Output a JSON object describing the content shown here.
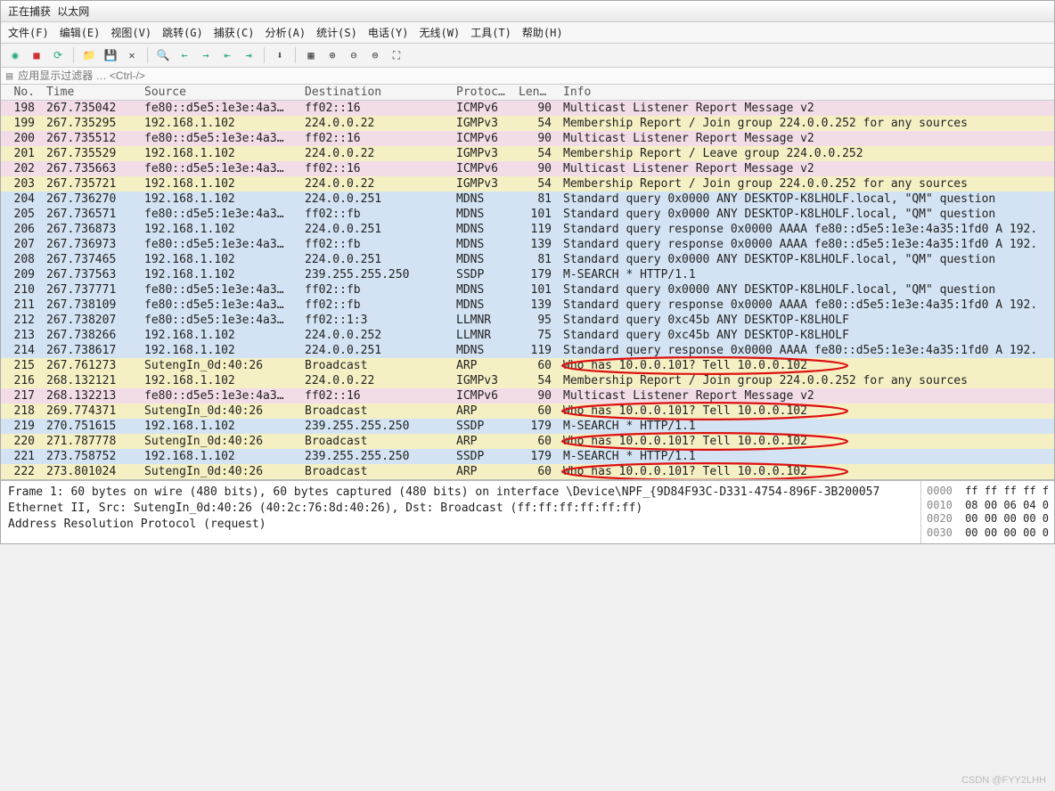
{
  "title": "正在捕获 以太网",
  "menu": [
    "文件(F)",
    "编辑(E)",
    "视图(V)",
    "跳转(G)",
    "捕获(C)",
    "分析(A)",
    "统计(S)",
    "电话(Y)",
    "无线(W)",
    "工具(T)",
    "帮助(H)"
  ],
  "filter_placeholder": "应用显示过滤器 … <Ctrl-/>",
  "columns": [
    "No.",
    "Time",
    "Source",
    "Destination",
    "Protocol",
    "Length",
    "Info"
  ],
  "rows": [
    {
      "no": "198",
      "time": "267.735042",
      "src": "fe80::d5e5:1e3e:4a3…",
      "dst": "ff02::16",
      "proto": "ICMPv6",
      "len": "90",
      "info": "Multicast Listener Report Message v2",
      "cls": "bg-pink"
    },
    {
      "no": "199",
      "time": "267.735295",
      "src": "192.168.1.102",
      "dst": "224.0.0.22",
      "proto": "IGMPv3",
      "len": "54",
      "info": "Membership Report / Join group 224.0.0.252 for any sources",
      "cls": "bg-yellow"
    },
    {
      "no": "200",
      "time": "267.735512",
      "src": "fe80::d5e5:1e3e:4a3…",
      "dst": "ff02::16",
      "proto": "ICMPv6",
      "len": "90",
      "info": "Multicast Listener Report Message v2",
      "cls": "bg-pink"
    },
    {
      "no": "201",
      "time": "267.735529",
      "src": "192.168.1.102",
      "dst": "224.0.0.22",
      "proto": "IGMPv3",
      "len": "54",
      "info": "Membership Report / Leave group 224.0.0.252",
      "cls": "bg-yellow"
    },
    {
      "no": "202",
      "time": "267.735663",
      "src": "fe80::d5e5:1e3e:4a3…",
      "dst": "ff02::16",
      "proto": "ICMPv6",
      "len": "90",
      "info": "Multicast Listener Report Message v2",
      "cls": "bg-pink"
    },
    {
      "no": "203",
      "time": "267.735721",
      "src": "192.168.1.102",
      "dst": "224.0.0.22",
      "proto": "IGMPv3",
      "len": "54",
      "info": "Membership Report / Join group 224.0.0.252 for any sources",
      "cls": "bg-yellow"
    },
    {
      "no": "204",
      "time": "267.736270",
      "src": "192.168.1.102",
      "dst": "224.0.0.251",
      "proto": "MDNS",
      "len": "81",
      "info": "Standard query 0x0000 ANY DESKTOP-K8LHOLF.local, \"QM\" question",
      "cls": "bg-blue"
    },
    {
      "no": "205",
      "time": "267.736571",
      "src": "fe80::d5e5:1e3e:4a3…",
      "dst": "ff02::fb",
      "proto": "MDNS",
      "len": "101",
      "info": "Standard query 0x0000 ANY DESKTOP-K8LHOLF.local, \"QM\" question",
      "cls": "bg-blue"
    },
    {
      "no": "206",
      "time": "267.736873",
      "src": "192.168.1.102",
      "dst": "224.0.0.251",
      "proto": "MDNS",
      "len": "119",
      "info": "Standard query response 0x0000 AAAA fe80::d5e5:1e3e:4a35:1fd0 A 192.",
      "cls": "bg-blue"
    },
    {
      "no": "207",
      "time": "267.736973",
      "src": "fe80::d5e5:1e3e:4a3…",
      "dst": "ff02::fb",
      "proto": "MDNS",
      "len": "139",
      "info": "Standard query response 0x0000 AAAA fe80::d5e5:1e3e:4a35:1fd0 A 192.",
      "cls": "bg-blue"
    },
    {
      "no": "208",
      "time": "267.737465",
      "src": "192.168.1.102",
      "dst": "224.0.0.251",
      "proto": "MDNS",
      "len": "81",
      "info": "Standard query 0x0000 ANY DESKTOP-K8LHOLF.local, \"QM\" question",
      "cls": "bg-blue"
    },
    {
      "no": "209",
      "time": "267.737563",
      "src": "192.168.1.102",
      "dst": "239.255.255.250",
      "proto": "SSDP",
      "len": "179",
      "info": "M-SEARCH * HTTP/1.1",
      "cls": "bg-blue"
    },
    {
      "no": "210",
      "time": "267.737771",
      "src": "fe80::d5e5:1e3e:4a3…",
      "dst": "ff02::fb",
      "proto": "MDNS",
      "len": "101",
      "info": "Standard query 0x0000 ANY DESKTOP-K8LHOLF.local, \"QM\" question",
      "cls": "bg-blue"
    },
    {
      "no": "211",
      "time": "267.738109",
      "src": "fe80::d5e5:1e3e:4a3…",
      "dst": "ff02::fb",
      "proto": "MDNS",
      "len": "139",
      "info": "Standard query response 0x0000 AAAA fe80::d5e5:1e3e:4a35:1fd0 A 192.",
      "cls": "bg-blue"
    },
    {
      "no": "212",
      "time": "267.738207",
      "src": "fe80::d5e5:1e3e:4a3…",
      "dst": "ff02::1:3",
      "proto": "LLMNR",
      "len": "95",
      "info": "Standard query 0xc45b ANY DESKTOP-K8LHOLF",
      "cls": "bg-blue"
    },
    {
      "no": "213",
      "time": "267.738266",
      "src": "192.168.1.102",
      "dst": "224.0.0.252",
      "proto": "LLMNR",
      "len": "75",
      "info": "Standard query 0xc45b ANY DESKTOP-K8LHOLF",
      "cls": "bg-blue"
    },
    {
      "no": "214",
      "time": "267.738617",
      "src": "192.168.1.102",
      "dst": "224.0.0.251",
      "proto": "MDNS",
      "len": "119",
      "info": "Standard query response 0x0000 AAAA fe80::d5e5:1e3e:4a35:1fd0 A 192.",
      "cls": "bg-blue"
    },
    {
      "no": "215",
      "time": "267.761273",
      "src": "SutengIn_0d:40:26",
      "dst": "Broadcast",
      "proto": "ARP",
      "len": "60",
      "info": "Who has 10.0.0.101? Tell 10.0.0.102",
      "cls": "bg-yellow"
    },
    {
      "no": "216",
      "time": "268.132121",
      "src": "192.168.1.102",
      "dst": "224.0.0.22",
      "proto": "IGMPv3",
      "len": "54",
      "info": "Membership Report / Join group 224.0.0.252 for any sources",
      "cls": "bg-yellow"
    },
    {
      "no": "217",
      "time": "268.132213",
      "src": "fe80::d5e5:1e3e:4a3…",
      "dst": "ff02::16",
      "proto": "ICMPv6",
      "len": "90",
      "info": "Multicast Listener Report Message v2",
      "cls": "bg-pink"
    },
    {
      "no": "218",
      "time": "269.774371",
      "src": "SutengIn_0d:40:26",
      "dst": "Broadcast",
      "proto": "ARP",
      "len": "60",
      "info": "Who has 10.0.0.101? Tell 10.0.0.102",
      "cls": "bg-yellow"
    },
    {
      "no": "219",
      "time": "270.751615",
      "src": "192.168.1.102",
      "dst": "239.255.255.250",
      "proto": "SSDP",
      "len": "179",
      "info": "M-SEARCH * HTTP/1.1",
      "cls": "bg-blue"
    },
    {
      "no": "220",
      "time": "271.787778",
      "src": "SutengIn_0d:40:26",
      "dst": "Broadcast",
      "proto": "ARP",
      "len": "60",
      "info": "Who has 10.0.0.101? Tell 10.0.0.102",
      "cls": "bg-yellow"
    },
    {
      "no": "221",
      "time": "273.758752",
      "src": "192.168.1.102",
      "dst": "239.255.255.250",
      "proto": "SSDP",
      "len": "179",
      "info": "M-SEARCH * HTTP/1.1",
      "cls": "bg-blue"
    },
    {
      "no": "222",
      "time": "273.801024",
      "src": "SutengIn_0d:40:26",
      "dst": "Broadcast",
      "proto": "ARP",
      "len": "60",
      "info": "Who has 10.0.0.101? Tell 10.0.0.102",
      "cls": "bg-yellow"
    }
  ],
  "details": {
    "line1": "Frame 1: 60 bytes on wire (480 bits), 60 bytes captured (480 bits) on interface \\Device\\NPF_{9D84F93C-D331-4754-896F-3B200057",
    "line2": "Ethernet II, Src: SutengIn_0d:40:26 (40:2c:76:8d:40:26), Dst: Broadcast (ff:ff:ff:ff:ff:ff)",
    "line3": "Address Resolution Protocol (request)"
  },
  "hex": [
    {
      "off": "0000",
      "bytes": "ff ff ff ff f"
    },
    {
      "off": "0010",
      "bytes": "08 00 06 04 0"
    },
    {
      "off": "0020",
      "bytes": "00 00 00 00 0"
    },
    {
      "off": "0030",
      "bytes": "00 00 00 00 0"
    }
  ],
  "watermark": "CSDN @FYY2LHH"
}
